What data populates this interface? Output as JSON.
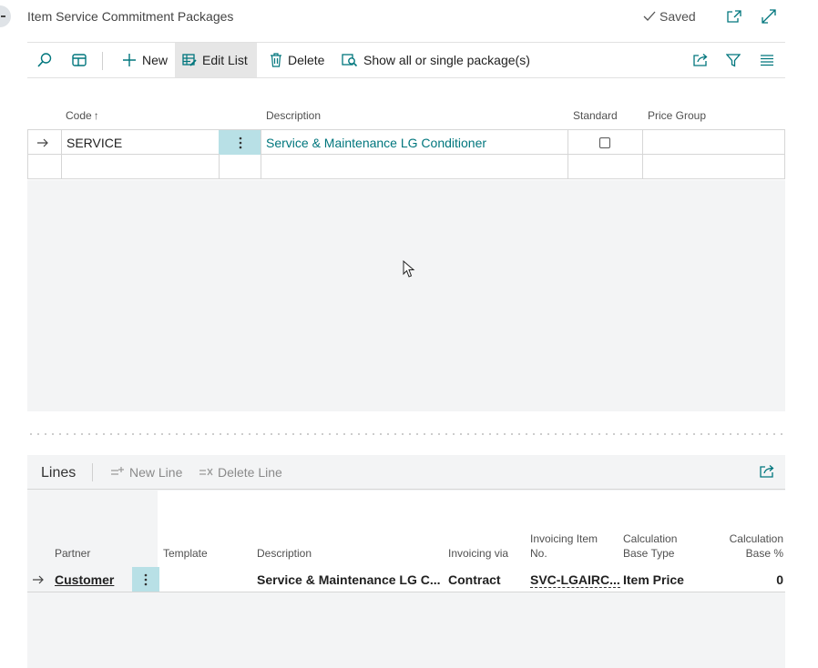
{
  "header": {
    "title": "Item Service Commitment Packages",
    "saved_label": "Saved",
    "icons": [
      "popout-icon",
      "expand-icon"
    ]
  },
  "actions": {
    "new_label": "New",
    "edit_list_label": "Edit List",
    "delete_label": "Delete",
    "show_all_label": "Show all or single package(s)",
    "icons": [
      "search-icon",
      "layout-icon",
      "share-icon",
      "filter-icon",
      "list-options-icon"
    ]
  },
  "list": {
    "columns": {
      "code": "Code",
      "sort_indicator": "↑",
      "description": "Description",
      "standard": "Standard",
      "price_group": "Price Group"
    },
    "rows": [
      {
        "code": "SERVICE",
        "description": "Service & Maintenance LG Conditioner",
        "standard": false,
        "price_group": ""
      }
    ]
  },
  "lines": {
    "title": "Lines",
    "new_line_label": "New Line",
    "delete_line_label": "Delete Line",
    "columns": {
      "partner": "Partner",
      "template": "Template",
      "description": "Description",
      "invoicing_via": "Invoicing via",
      "invoicing_item_no_1": "Invoicing Item",
      "invoicing_item_no_2": "No.",
      "calc_base_type_1": "Calculation",
      "calc_base_type_2": "Base Type",
      "calc_base_pct_1": "Calculation",
      "calc_base_pct_2": "Base %"
    },
    "rows": [
      {
        "partner": "Customer",
        "template": "",
        "description": "Service & Maintenance LG C...",
        "invoicing_via": "Contract",
        "invoicing_item_no": "SVC-LGAIRC...",
        "calc_base_type": "Item Price",
        "calc_base_pct": "0"
      }
    ]
  },
  "colors": {
    "accent": "#00767d",
    "selection": "#b8e0e6",
    "muted_bg": "#f3f4f5"
  }
}
